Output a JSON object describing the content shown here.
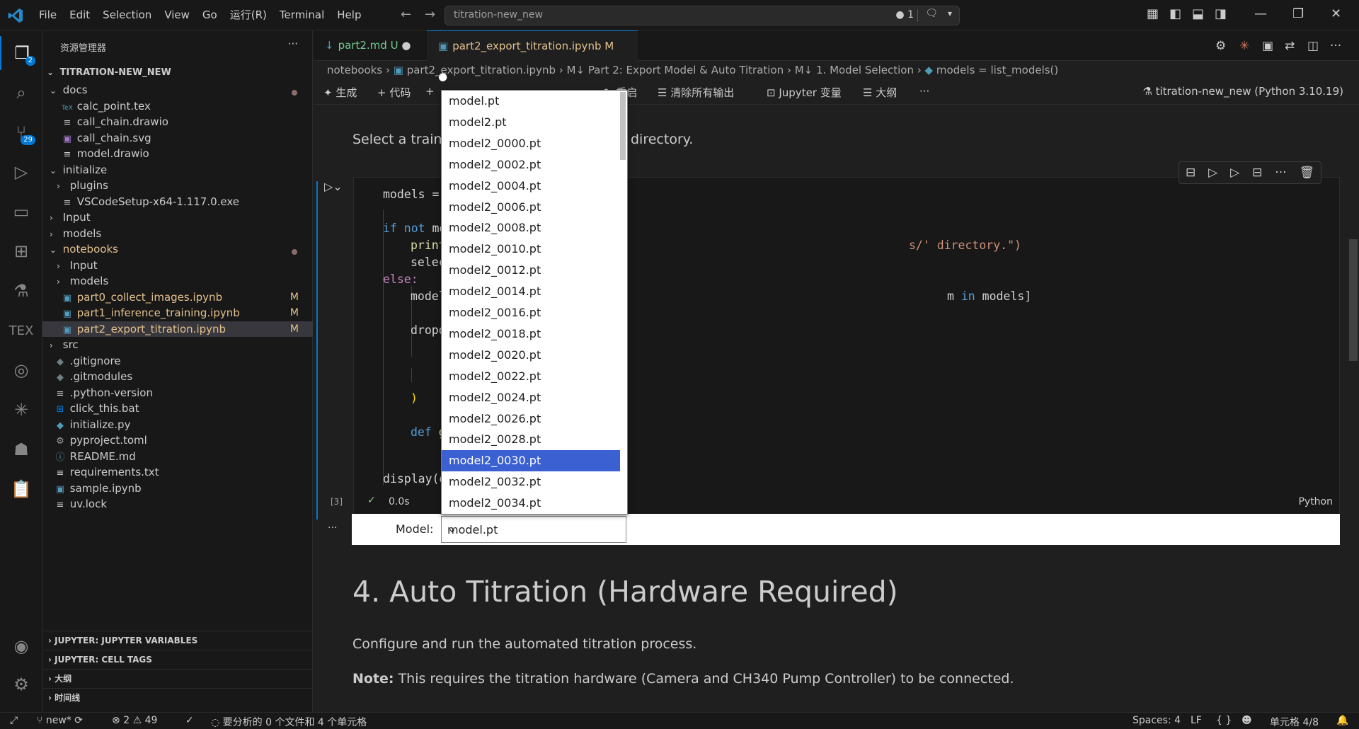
{
  "titlebar": {
    "menus": [
      "File",
      "Edit",
      "Selection",
      "View",
      "Go",
      "运行(R)",
      "Terminal",
      "Help"
    ],
    "search": "titration-new_new",
    "notif_count": "1"
  },
  "activity": {
    "explorer_badge": "2",
    "scm_badge": "29"
  },
  "sidebar": {
    "title": "资源管理器",
    "root": "TITRATION-NEW_NEW",
    "items": [
      {
        "label": "docs",
        "type": "folder-open",
        "indent": 1,
        "dot": true
      },
      {
        "label": "calc_point.tex",
        "type": "tex",
        "indent": 2
      },
      {
        "label": "call_chain.drawio",
        "type": "file",
        "indent": 2
      },
      {
        "label": "call_chain.svg",
        "type": "svg",
        "indent": 2
      },
      {
        "label": "model.drawio",
        "type": "file",
        "indent": 2
      },
      {
        "label": "initialize",
        "type": "folder-open",
        "indent": 1
      },
      {
        "label": "plugins",
        "type": "folder",
        "indent": 2
      },
      {
        "label": "VSCodeSetup-x64-1.117.0.exe",
        "type": "file",
        "indent": 2
      },
      {
        "label": "Input",
        "type": "folder",
        "indent": 1
      },
      {
        "label": "models",
        "type": "folder",
        "indent": 1
      },
      {
        "label": "notebooks",
        "type": "folder-open",
        "indent": 1,
        "dot": true,
        "mod": true
      },
      {
        "label": "Input",
        "type": "folder",
        "indent": 2
      },
      {
        "label": "models",
        "type": "folder",
        "indent": 2
      },
      {
        "label": "part0_collect_images.ipynb",
        "type": "nb",
        "indent": 2,
        "badge": "M",
        "mod": true
      },
      {
        "label": "part1_inference_training.ipynb",
        "type": "nb",
        "indent": 2,
        "badge": "M",
        "mod": true
      },
      {
        "label": "part2_export_titration.ipynb",
        "type": "nb",
        "indent": 2,
        "badge": "M",
        "mod": true,
        "selected": true
      },
      {
        "label": "src",
        "type": "folder",
        "indent": 1
      },
      {
        "label": ".gitignore",
        "type": "git",
        "indent": 1
      },
      {
        "label": ".gitmodules",
        "type": "git",
        "indent": 1
      },
      {
        "label": ".python-version",
        "type": "file",
        "indent": 1
      },
      {
        "label": "click_this.bat",
        "type": "win",
        "indent": 1
      },
      {
        "label": "initialize.py",
        "type": "py",
        "indent": 1
      },
      {
        "label": "pyproject.toml",
        "type": "gear",
        "indent": 1
      },
      {
        "label": "README.md",
        "type": "info",
        "indent": 1
      },
      {
        "label": "requirements.txt",
        "type": "file",
        "indent": 1
      },
      {
        "label": "sample.ipynb",
        "type": "nb",
        "indent": 1
      },
      {
        "label": "uv.lock",
        "type": "file",
        "indent": 1
      }
    ],
    "sections": [
      "JUPYTER: JUPYTER VARIABLES",
      "JUPYTER: CELL TAGS",
      "大纲",
      "时间线"
    ]
  },
  "tabs": [
    {
      "label": "part2.md",
      "status": "U"
    },
    {
      "label": "part2_export_titration.ipynb",
      "status": "M"
    }
  ],
  "breadcrumb": [
    "notebooks",
    "part2_export_titration.ipynb",
    "Part 2: Export Model & Auto Titration",
    "1. Model Selection",
    "models = list_models()"
  ],
  "toolbar": {
    "generate": "生成",
    "code": "代码",
    "restart": "重启",
    "clear": "清除所有输出",
    "variables": "Jupyter 变量",
    "outline": "大纲",
    "kernel": "titration-new_new (Python 3.10.19)"
  },
  "notebook": {
    "intro_left": "Select a traine",
    "intro_right": "directory.",
    "code_lines": {
      "l1": "models = ",
      "l2a": "if not ",
      "l2b": "mo",
      "l3a": "print",
      "l3b": "s/' directory.\")",
      "l4": "selec",
      "l5": "else:",
      "l6a": "model",
      "l6b": "m ",
      "l6c": "in",
      "l6d": " models]",
      "l7": "dropd",
      "l8": ")",
      "l9a": "def ",
      "l9b": "g",
      "l10": "display(d"
    },
    "exec_count": "[3]",
    "exec_time": "0.0s",
    "language": "Python",
    "widget_label": "Model:",
    "selected_value": "model.pt",
    "heading": "4. Auto Titration (Hardware Required)",
    "para1": "Configure and run the automated titration process.",
    "note_bold": "Note:",
    "note_text": " This requires the titration hardware (Camera and CH340 Pump Controller) to be connected."
  },
  "dropdown": {
    "options": [
      "model.pt",
      "model2.pt",
      "model2_0000.pt",
      "model2_0002.pt",
      "model2_0004.pt",
      "model2_0006.pt",
      "model2_0008.pt",
      "model2_0010.pt",
      "model2_0012.pt",
      "model2_0014.pt",
      "model2_0016.pt",
      "model2_0018.pt",
      "model2_0020.pt",
      "model2_0022.pt",
      "model2_0024.pt",
      "model2_0026.pt",
      "model2_0028.pt",
      "model2_0030.pt",
      "model2_0032.pt",
      "model2_0034.pt"
    ],
    "highlighted": "model2_0030.pt"
  },
  "statusbar": {
    "branch": "new*",
    "errors": "2",
    "warnings": "49",
    "analysis": "要分析的 0 个文件和 4 个单元格",
    "spaces": "Spaces: 4",
    "eol": "LF",
    "braces": "{ }",
    "cell": "单元格 4/8"
  }
}
